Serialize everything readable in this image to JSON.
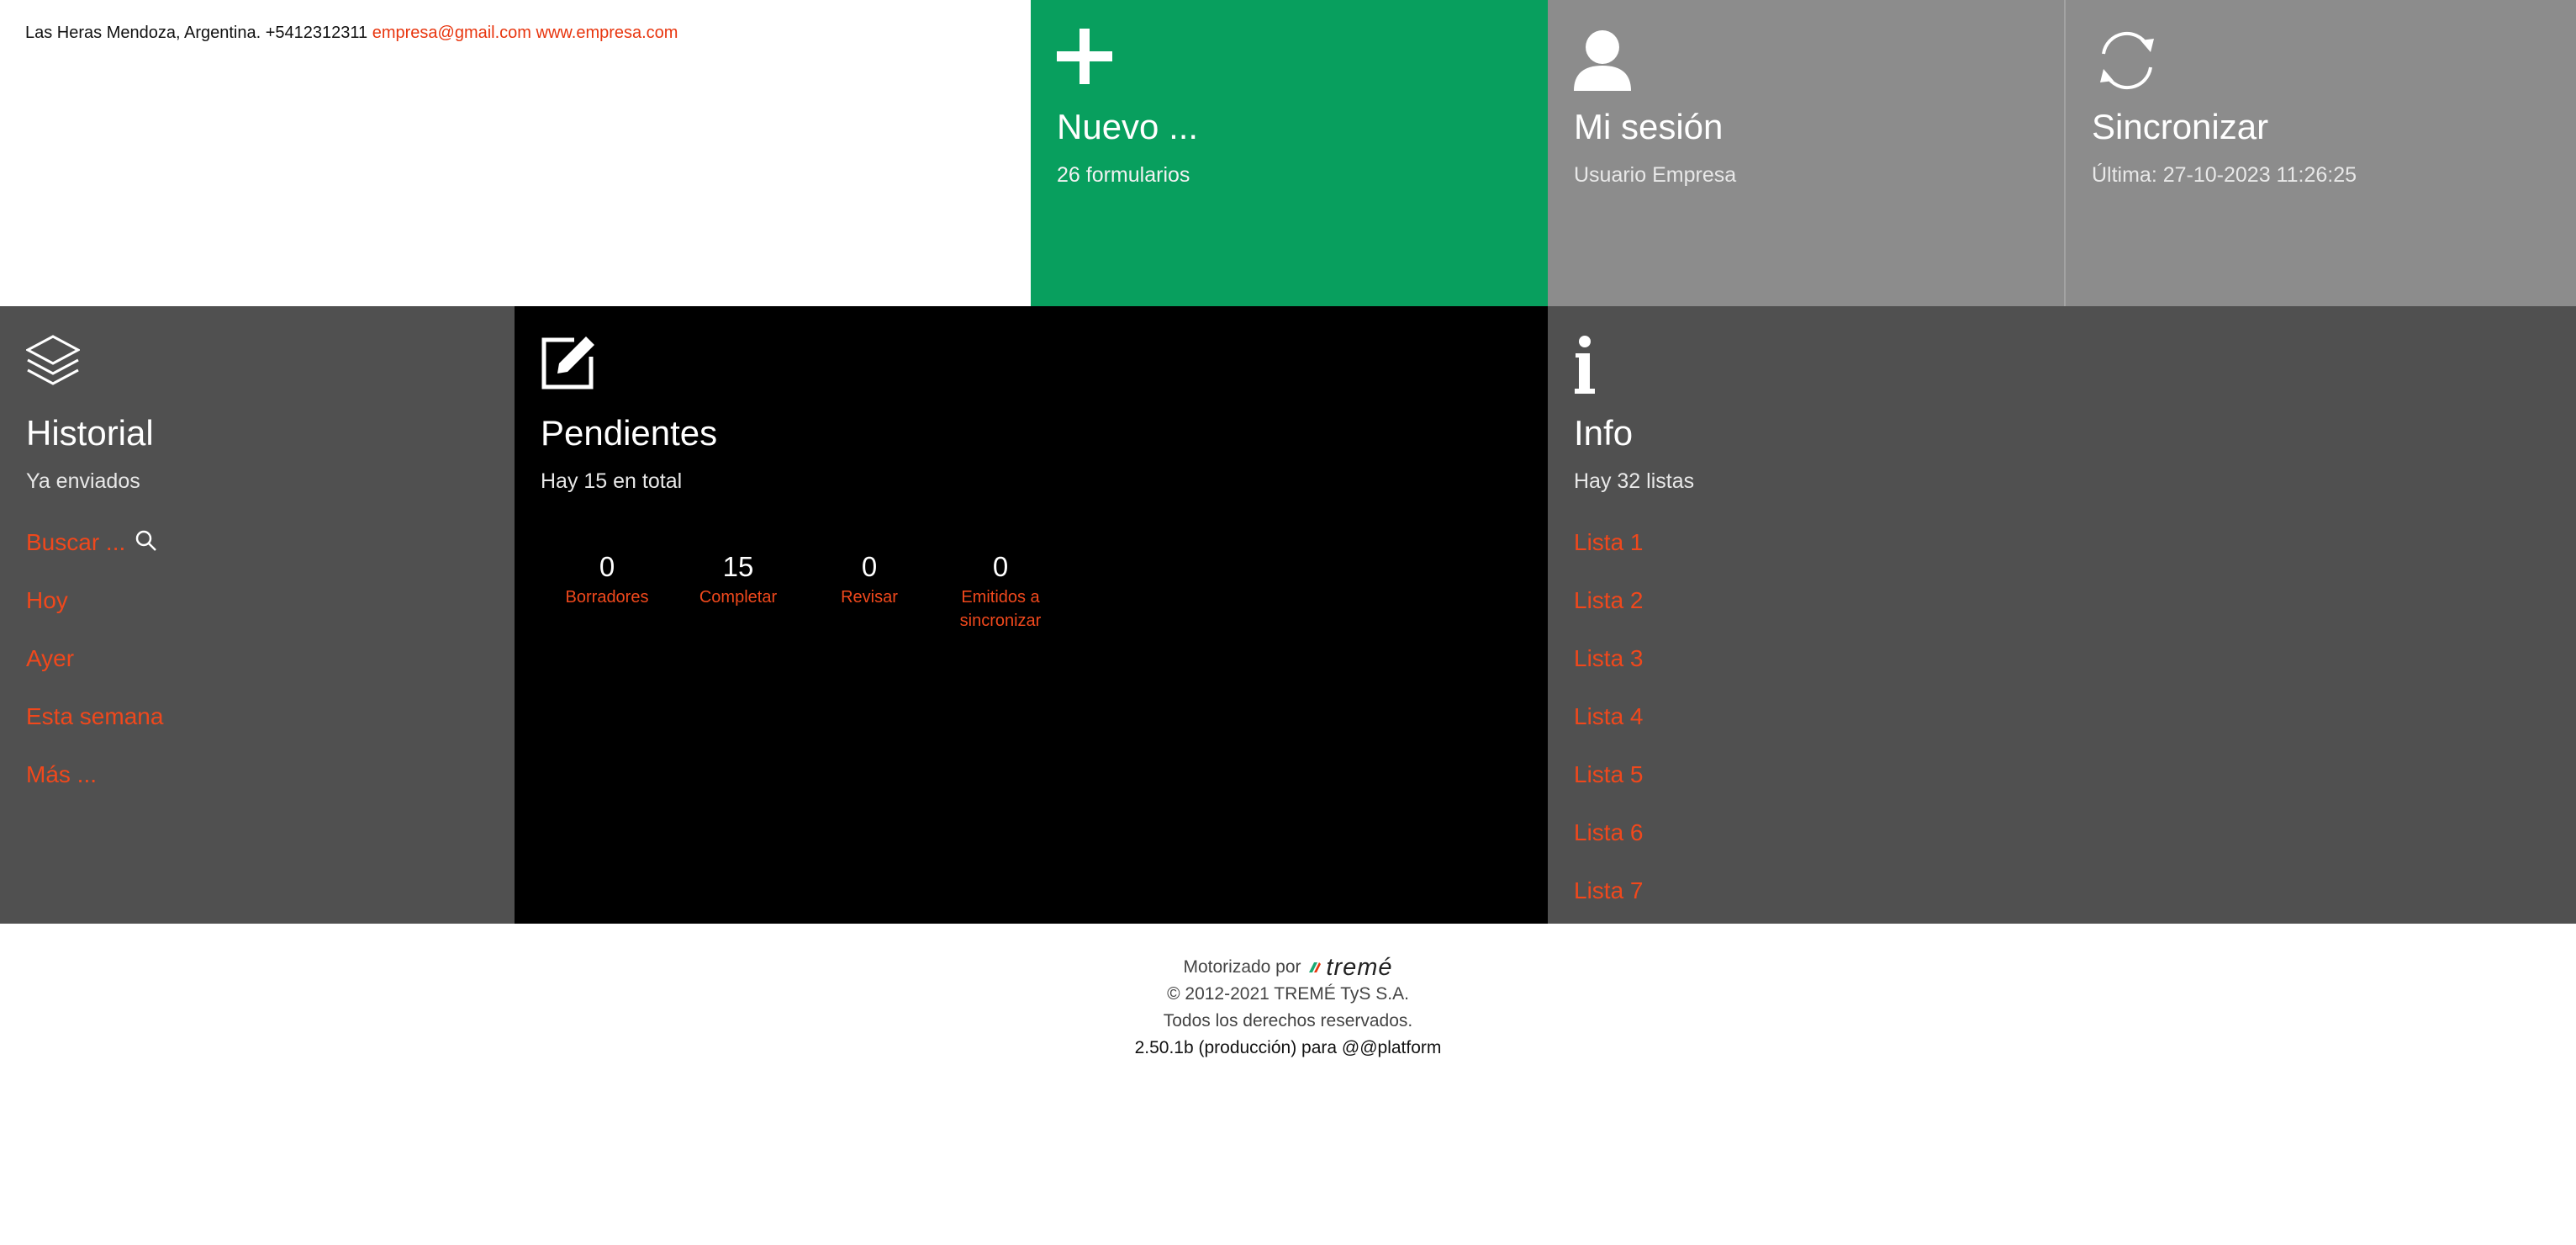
{
  "header": {
    "address": "Las Heras Mendoza, Argentina. +5412312311",
    "email": "empresa@gmail.com",
    "website": "www.empresa.com"
  },
  "tiles": {
    "nuevo": {
      "title": "Nuevo ...",
      "subtitle": "26 formularios",
      "icon": "plus-icon",
      "color": "#089f5e"
    },
    "sesion": {
      "title": "Mi sesión",
      "subtitle": "Usuario Empresa",
      "icon": "user-icon",
      "color": "#8c8c8c"
    },
    "sync": {
      "title": "Sincronizar",
      "subtitle": "Última: 27-10-2023 11:26:25",
      "icon": "sync-icon",
      "color": "#8c8c8c"
    },
    "historial": {
      "title": "Historial",
      "subtitle": "Ya enviados",
      "icon": "layers-icon",
      "color": "#505050",
      "links": [
        "Buscar ...",
        "Hoy",
        "Ayer",
        "Esta semana",
        "Más ..."
      ]
    },
    "pendientes": {
      "title": "Pendientes",
      "subtitle": "Hay 15 en total",
      "icon": "edit-icon",
      "color": "#000000",
      "counters": [
        {
          "value": "0",
          "label": "Borradores"
        },
        {
          "value": "15",
          "label": "Completar"
        },
        {
          "value": "0",
          "label": "Revisar"
        },
        {
          "value": "0",
          "label": "Emitidos a sincronizar"
        }
      ]
    },
    "info": {
      "title": "Info",
      "subtitle": "Hay 32 listas",
      "icon": "info-icon",
      "color": "#505050",
      "links": [
        "Lista 1",
        "Lista 2",
        "Lista 3",
        "Lista 4",
        "Lista 5",
        "Lista 6",
        "Lista 7"
      ]
    }
  },
  "footer": {
    "powered_by": "Motorizado por",
    "brand": "tremé",
    "copyright": "© 2012-2021 TREMÉ TyS S.A.",
    "rights": "Todos los derechos reservados.",
    "version": "2.50.1b (producción) para @@platform"
  },
  "colors": {
    "accent_link": "#f0481c",
    "green": "#089f5e"
  }
}
